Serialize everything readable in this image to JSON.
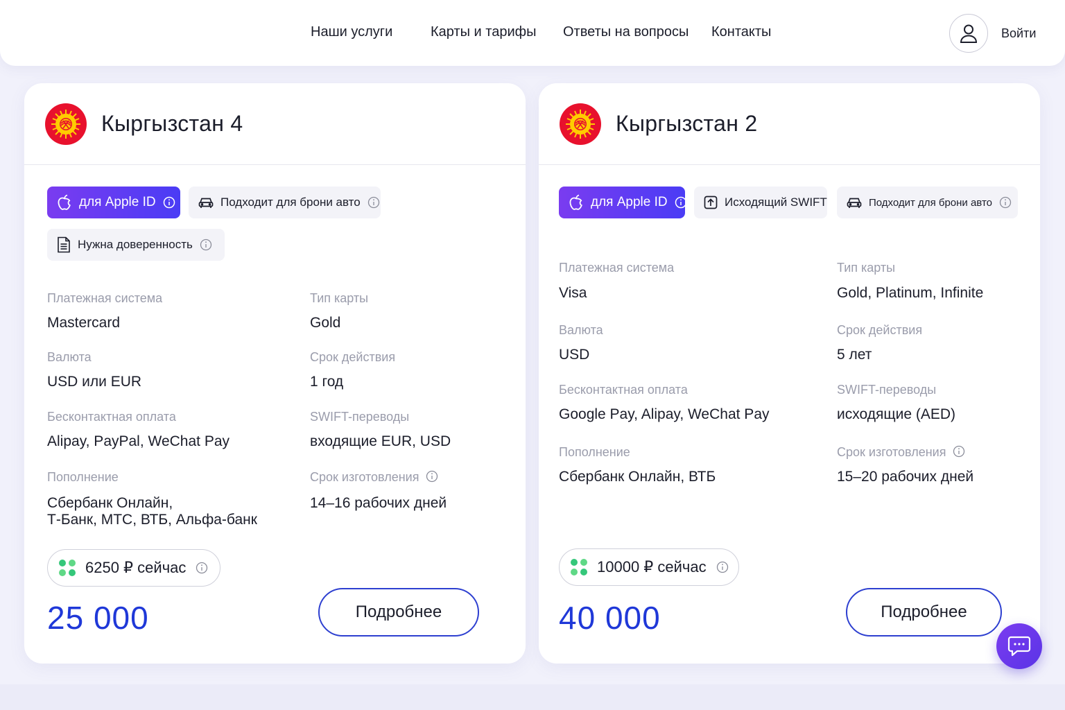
{
  "header": {
    "nav": [
      {
        "label": "Наши услуги"
      },
      {
        "label": "Карты и тарифы"
      },
      {
        "label": "Ответы на вопросы"
      },
      {
        "label": "Контакты"
      }
    ],
    "login_label": "Войти"
  },
  "cards": [
    {
      "title": "Кыргызстан 4",
      "chips": [
        {
          "label": "для Apple ID",
          "icon": "apple-icon"
        },
        {
          "label": "Подходит для брони авто",
          "icon": "car-icon"
        },
        {
          "label": "Нужна доверенность",
          "icon": "document-icon"
        }
      ],
      "fields": {
        "payment_system": {
          "label": "Платежная система",
          "value": "Mastercard"
        },
        "card_type": {
          "label": "Тип карты",
          "value": "Gold"
        },
        "currency": {
          "label": "Валюта",
          "value": "USD или EUR"
        },
        "validity": {
          "label": "Срок действия",
          "value": "1 год"
        },
        "contactless": {
          "label": "Бесконтактная оплата",
          "value": "Alipay, PayPal, WeChat Pay"
        },
        "swift": {
          "label": "SWIFT-переводы",
          "value": "входящие EUR, USD"
        },
        "topup": {
          "label": "Пополнение",
          "value_line1": "Сбербанк Онлайн,",
          "value_line2": "Т-Банк, МТС, ВТБ, Альфа-банк"
        },
        "production": {
          "label": "Срок изготовления",
          "value": "14–16 рабочих дней"
        }
      },
      "now_price": "6250 ₽  сейчас",
      "price": "25 000",
      "more_label": "Подробнее"
    },
    {
      "title": "Кыргызстан 2",
      "chips": [
        {
          "label": "для Apple ID",
          "icon": "apple-icon"
        },
        {
          "label": "Исходящий SWIFT",
          "icon": "upload-icon"
        },
        {
          "label": "Подходит для брони авто",
          "icon": "car-icon"
        }
      ],
      "fields": {
        "payment_system": {
          "label": "Платежная система",
          "value": "Visa"
        },
        "card_type": {
          "label": "Тип карты",
          "value": "Gold, Platinum, Infinite"
        },
        "currency": {
          "label": "Валюта",
          "value": "USD"
        },
        "validity": {
          "label": "Срок действия",
          "value": "5 лет"
        },
        "contactless": {
          "label": "Бесконтактная оплата",
          "value": "Google Pay, Alipay, WeChat Pay"
        },
        "swift": {
          "label": "SWIFT-переводы",
          "value": "исходящие (AED)"
        },
        "topup": {
          "label": "Пополнение",
          "value": "Сбербанк Онлайн, ВТБ"
        },
        "production": {
          "label": "Срок изготовления",
          "value": "15–20 рабочих дней"
        }
      },
      "now_price": "10000 ₽  сейчас",
      "price": "40 000",
      "more_label": "Подробнее"
    }
  ],
  "colors": {
    "accent_price": "#1f38d8",
    "chip_gradient_start": "#7a3cf0",
    "chip_gradient_end": "#4a3cf5",
    "flag_red": "#e8112d",
    "flag_sun": "#ffcc00",
    "dot_green": "#35c77a"
  },
  "icons": {
    "login": "user-icon",
    "chat": "chat-bubble-icon",
    "flag": "kyrgyzstan-flag-icon",
    "info": "info-icon"
  }
}
